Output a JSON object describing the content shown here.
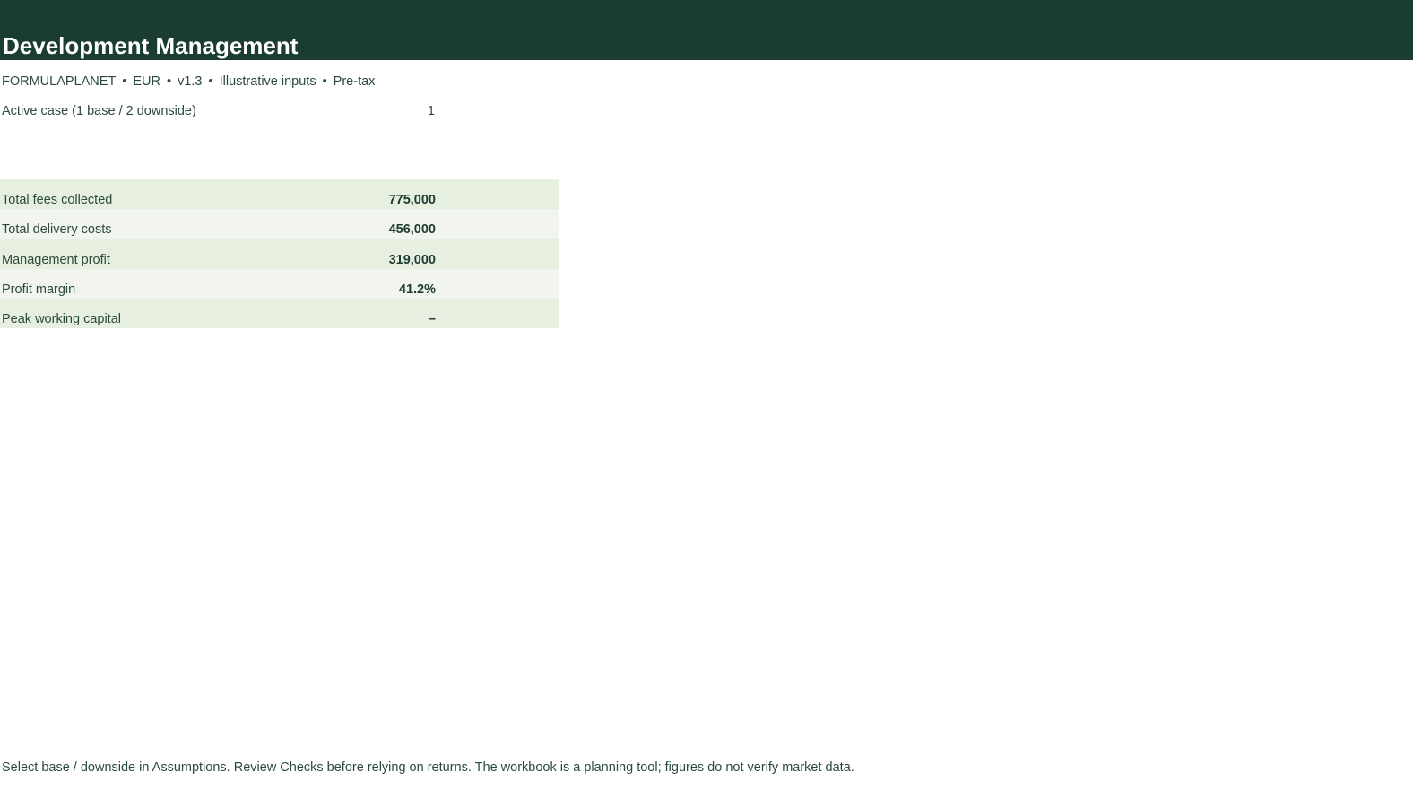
{
  "header": {
    "title": "Development Management",
    "bg_color": "#1b3d31"
  },
  "meta": {
    "items": [
      "FORMULAPLANET",
      "EUR",
      "v1.3",
      "Illustrative inputs",
      "Pre-tax"
    ],
    "separator": "•"
  },
  "active_case": {
    "label": "Active case (1 base / 2 downside)",
    "value": "1"
  },
  "kpis": [
    {
      "label": "Total fees collected",
      "value": "775,000"
    },
    {
      "label": "Total delivery costs",
      "value": "456,000"
    },
    {
      "label": "Management profit",
      "value": "319,000"
    },
    {
      "label": "Profit margin",
      "value": "41.2%"
    },
    {
      "label": "Peak working capital",
      "value": "–"
    }
  ],
  "footer": {
    "note": "Select base / downside in Assumptions. Review Checks before relying on returns. The workbook is a planning tool; figures do not verify market data."
  },
  "colors": {
    "row_odd": "#e6efe0",
    "row_even": "#f1f5ee",
    "text": "#2b4a3d"
  }
}
